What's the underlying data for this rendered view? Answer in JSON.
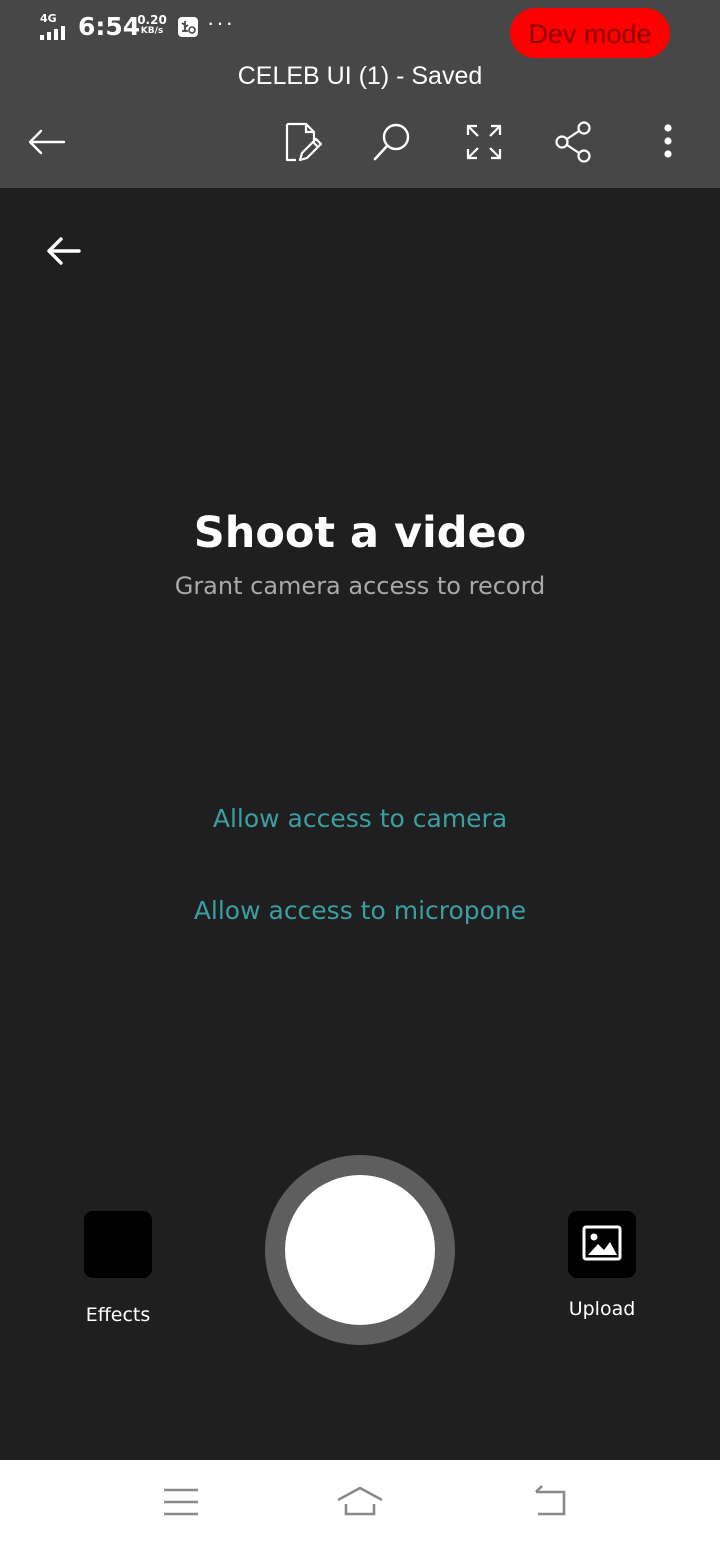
{
  "status_bar": {
    "network": "4G",
    "time": "6:54",
    "speed_value": "0.20",
    "speed_unit": "KB/s",
    "more": "···",
    "dev_mode_label": "Dev mode"
  },
  "app_bar": {
    "title": "CELEB UI (1) - Saved",
    "icons": [
      "back-arrow-icon",
      "edit-document-icon",
      "search-icon",
      "fullscreen-icon",
      "share-icon",
      "more-vert-icon"
    ]
  },
  "camera": {
    "headline": "Shoot a video",
    "subline": "Grant camera access to record",
    "camera_permission": "Allow access to camera",
    "mic_permission": "Allow access to micropone",
    "effects_label": "Effects",
    "upload_label": "Upload"
  },
  "nav_bar": {
    "icons": [
      "menu-icon",
      "home-icon",
      "back-icon"
    ]
  },
  "colors": {
    "toolbar_bg": "#474747",
    "screen_bg": "#1f1f1f",
    "dev_pill": "#ff0000",
    "link_teal": "#3b9ea3",
    "shutter_ring": "#5e5e5e"
  }
}
